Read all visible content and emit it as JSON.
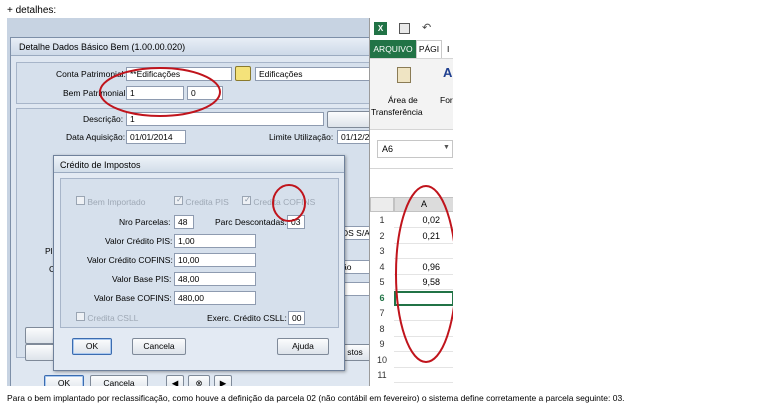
{
  "doc": {
    "intro": "+ detalhes:",
    "caption": "Para o bem implantado por reclassificação, como houve a definição da parcela 02 (não contábil em fevereiro) o sistema define corretamente a parcela seguinte: 03."
  },
  "main_window": {
    "title": "Detalhe Dados Básico Bem (1.00.00.020)",
    "conta_label": "Conta Patrimonial:",
    "conta_code": "**Edificações",
    "conta_desc": "Edificações",
    "bem_label": "Bem Patrimonial:",
    "bem_value": "1",
    "bem_inc": "0",
    "descricao_label": "Descrição:",
    "descricao_value": "1",
    "data_label": "Data Aquisição:",
    "data_value": "01/01/2014",
    "limite_label": "Limite Utilização:",
    "limite_value": "01/12/2",
    "partial_text_1": "DS S/A",
    "partial_text_2": "ão",
    "partial_label_pl": "Pl",
    "partial_label_c": "C",
    "partial_btn": "stos",
    "ok": "OK",
    "cancel": "Cancela"
  },
  "dialog": {
    "title": "Crédito de Impostos",
    "bem_importado": "Bem Importado",
    "credita_pis": "Credita PIS",
    "credita_cofins": "Credita COFINS",
    "nro_parcelas_label": "Nro Parcelas:",
    "nro_parcelas": "48",
    "parc_desc_label": "Parc Descontadas:",
    "parc_desc": "03",
    "valor_credito_pis_label": "Valor Crédito PIS:",
    "valor_credito_pis": "1,00",
    "valor_credito_cofins_label": "Valor Crédito COFINS:",
    "valor_credito_cofins": "10,00",
    "valor_base_pis_label": "Valor Base PIS:",
    "valor_base_pis": "48,00",
    "valor_base_cofins_label": "Valor Base COFINS:",
    "valor_base_cofins": "480,00",
    "credita_csll": "Credita CSLL",
    "exerc_label": "Exerc. Crédito CSLL:",
    "exerc_value": "00",
    "ok": "OK",
    "cancel": "Cancela",
    "help": "Ajuda"
  },
  "excel": {
    "tab_arquivo": "ARQUIVO",
    "tab_pagina": "PÁGI",
    "tab_partial": "I",
    "clipboard_line1": "Área de",
    "clipboard_line2": "Transferência",
    "font_partial": "For",
    "namebox": "A6",
    "column": "A",
    "rows": [
      {
        "n": "1",
        "v": "0,02"
      },
      {
        "n": "2",
        "v": "0,21"
      },
      {
        "n": "3",
        "v": ""
      },
      {
        "n": "4",
        "v": "0,96"
      },
      {
        "n": "5",
        "v": "9,58"
      },
      {
        "n": "6",
        "v": ""
      },
      {
        "n": "7",
        "v": ""
      },
      {
        "n": "8",
        "v": ""
      },
      {
        "n": "9",
        "v": ""
      },
      {
        "n": "10",
        "v": ""
      },
      {
        "n": "11",
        "v": ""
      }
    ],
    "brand_color": "#217346"
  },
  "annotation_color": "#c0141c"
}
